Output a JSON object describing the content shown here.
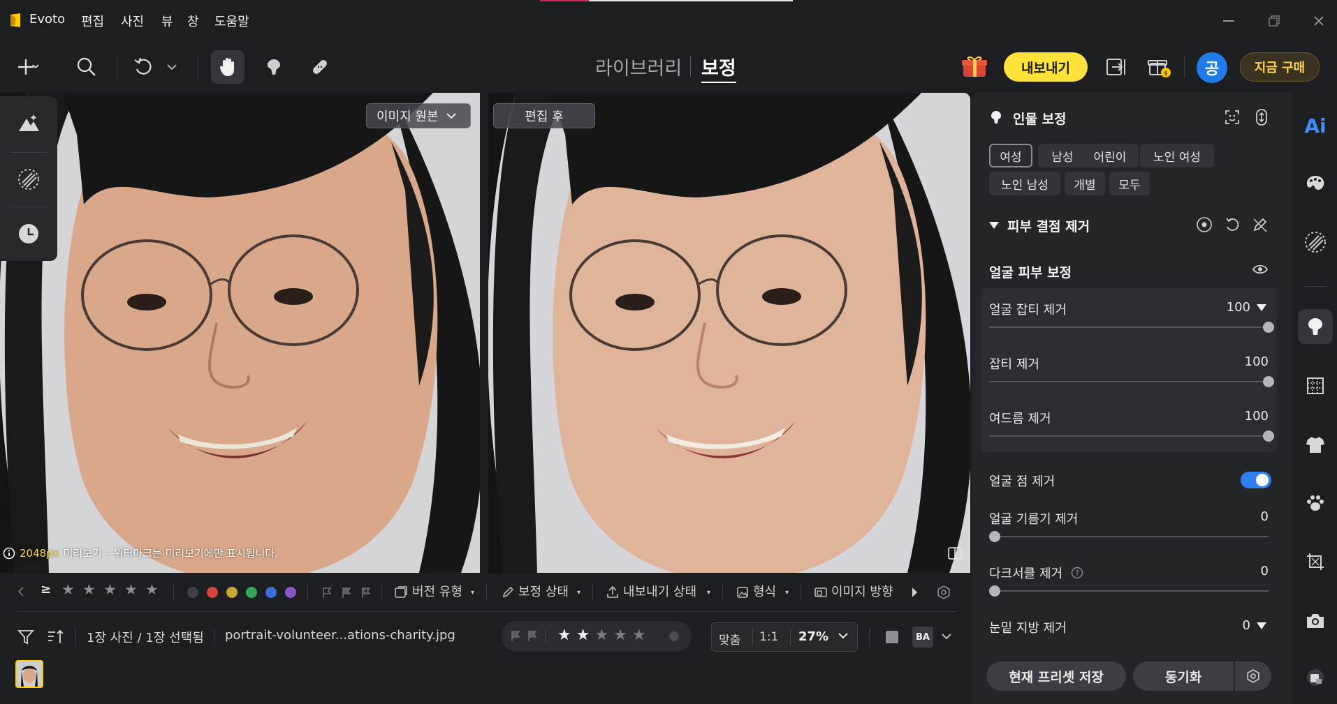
{
  "app": {
    "name": "Evoto"
  },
  "menu": [
    "편집",
    "사진",
    "뷰",
    "창",
    "도움말"
  ],
  "window_controls": {
    "minimize_icon": "minimize-icon",
    "restore_icon": "restore-icon",
    "close_icon": "close-icon"
  },
  "toolbar": {
    "main_tabs": [
      {
        "label": "라이브러리",
        "active": false
      },
      {
        "label": "보정",
        "active": true
      }
    ],
    "export_label": "내보내기",
    "buy_label": "지금 구매",
    "avatar_label": "공"
  },
  "canvas": {
    "before_label": "이미지 원본",
    "after_label": "편집 후",
    "preview_size": "2048px",
    "preview_note": "미리보기 – 워터마크는 미리보기에만 표시됩니다."
  },
  "bottom": {
    "ge_symbol": "≥",
    "version_type": "버전 유형",
    "retouch_status": "보정 상태",
    "export_status": "내보내기 상태",
    "format": "형식",
    "orientation": "이미지 방향",
    "color_labels": [
      "#3e4046",
      "#d4453a",
      "#c9a933",
      "#39a75b",
      "#3a6fd8",
      "#8a55c9"
    ],
    "selection_info": "1장 사진 / 1장 선택됨",
    "file_name": "portrait-volunteer...ations-charity.jpg",
    "rating": 2,
    "rating_max": 5,
    "fit_label": "맞춤",
    "one_to_one": "1:1",
    "zoom": "27%",
    "ba_label": "BA"
  },
  "panel": {
    "title": "인물 보정",
    "presets": [
      "여성",
      "남성",
      "어린이",
      "노인 여성",
      "노인 남성",
      "개별",
      "모두"
    ],
    "selected_preset": "여성",
    "section_title": "피부 결점 제거",
    "subsection_title": "얼굴 피부 보정",
    "sliders": [
      {
        "label": "얼굴 잡티 제거",
        "value": "100"
      },
      {
        "label": "잡티 제거",
        "value": "100"
      },
      {
        "label": "여드름 제거",
        "value": "100"
      }
    ],
    "face_spot_label": "얼굴 점 제거",
    "face_spot_enabled": true,
    "sliders2": [
      {
        "label": "얼굴 기름기 제거",
        "value": "0"
      },
      {
        "label": "다크서클 제거",
        "value": "0"
      },
      {
        "label": "눈밑 지방 제거",
        "value": "0"
      }
    ],
    "save_preset_label": "현재 프리셋 저장",
    "sync_label": "동기화"
  },
  "rail_label": "Ai"
}
